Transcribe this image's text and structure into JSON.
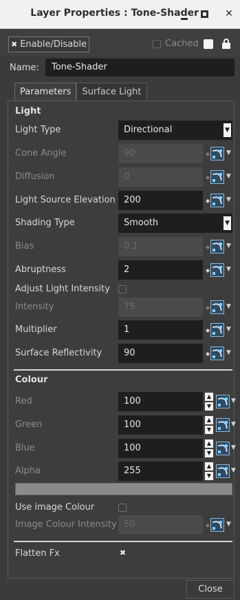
{
  "window": {
    "title": "Layer Properties : Tone-Shader",
    "minimize_icon": "minimize-icon",
    "maximize_icon": "maximize-icon",
    "close_icon": "close-icon"
  },
  "topbar": {
    "enable_label": "Enable/Disable",
    "enable_checked": true,
    "cached_label": "Cached",
    "cached_checked": false
  },
  "name": {
    "label": "Name:",
    "value": "Tone-Shader"
  },
  "tabs": [
    {
      "label": "Parameters",
      "active": true
    },
    {
      "label": "Surface Light",
      "active": false
    }
  ],
  "light": {
    "section_title": "Light",
    "light_type": {
      "label": "Light Type",
      "value": "Directional"
    },
    "cone_angle": {
      "label": "Cone Angle",
      "value": "90"
    },
    "diffusion": {
      "label": "Diffusion",
      "value": "0"
    },
    "elevation": {
      "label": "Light Source Elevation",
      "value": "200"
    },
    "shading_type": {
      "label": "Shading Type",
      "value": "Smooth"
    },
    "bias": {
      "label": "Bias",
      "value": "0.1"
    },
    "abruptness": {
      "label": "Abruptness",
      "value": "2"
    },
    "adjust_intensity": {
      "label": "Adjust Light Intensity",
      "checked": false
    },
    "intensity": {
      "label": "Intensity",
      "value": "75"
    },
    "multiplier": {
      "label": "Multiplier",
      "value": "1"
    },
    "reflectivity": {
      "label": "Surface Reflectivity",
      "value": "90"
    }
  },
  "colour": {
    "section_title": "Colour",
    "red": {
      "label": "Red",
      "value": "100"
    },
    "green": {
      "label": "Green",
      "value": "100"
    },
    "blue": {
      "label": "Blue",
      "value": "100"
    },
    "alpha": {
      "label": "Alpha",
      "value": "255"
    },
    "swatch_color": "#8a8a8a",
    "use_image": {
      "label": "Use image Colour",
      "checked": false
    },
    "image_intensity": {
      "label": "Image Colour Intensity",
      "value": "50"
    }
  },
  "flatten": {
    "label": "Flatten Fx",
    "checked": true
  },
  "footer": {
    "close_label": "Close"
  }
}
